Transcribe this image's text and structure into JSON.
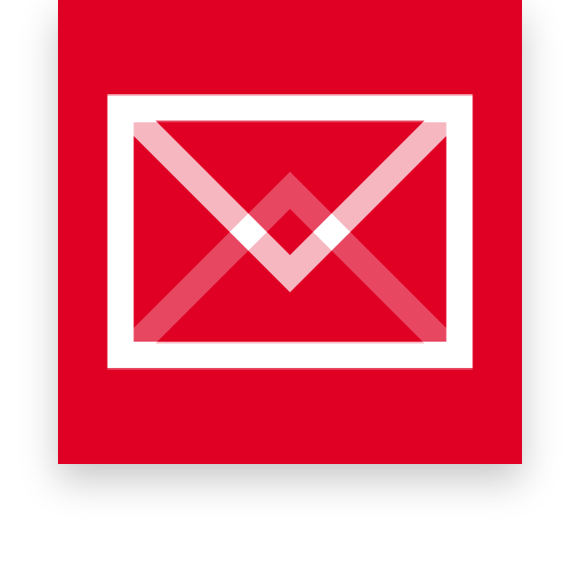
{
  "tile": {
    "icon": "mail-envelope-icon",
    "background_color": "#e00024",
    "icon_color": "#ffffff"
  }
}
